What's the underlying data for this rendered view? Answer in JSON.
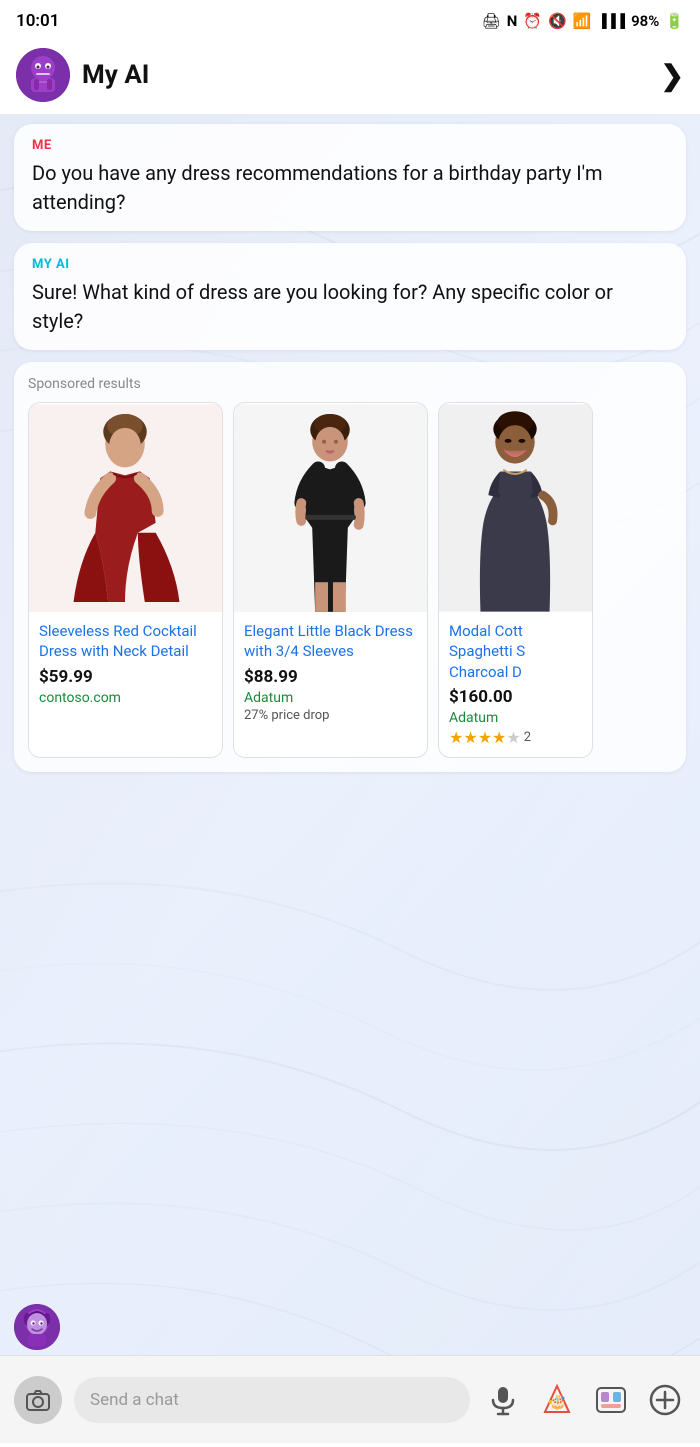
{
  "status": {
    "time": "10:01",
    "battery": "98%"
  },
  "header": {
    "title": "My AI",
    "chevron": "❯"
  },
  "messages": [
    {
      "sender_label": "ME",
      "sender_class": "sender-me",
      "text": "Do you have any dress recommendations for a birthday party I'm attending?"
    },
    {
      "sender_label": "MY AI",
      "sender_class": "sender-ai",
      "text": "Sure! What kind of dress are you looking for? Any specific color or style?"
    }
  ],
  "sponsored": {
    "label": "Sponsored results",
    "products": [
      {
        "name": "Sleeveless Red Cocktail Dress with Neck Detail",
        "price": "$59.99",
        "store": "contoso.com",
        "badge": "",
        "stars": 0,
        "color": "#8b1a2a",
        "accent": "#c0392b"
      },
      {
        "name": "Elegant Little Black Dress with 3/4 Sleeves",
        "price": "$88.99",
        "store": "Adatum",
        "badge": "27% price drop",
        "stars": 0,
        "color": "#1a1a1a",
        "accent": "#333"
      },
      {
        "name": "Modal Cott Spaghetti S Charcoal D",
        "price": "$160.00",
        "store": "Adatum",
        "badge": "",
        "stars": 4,
        "color": "#2c3e50",
        "accent": "#34495e"
      }
    ]
  },
  "bottom": {
    "chat_placeholder": "Send a chat"
  }
}
